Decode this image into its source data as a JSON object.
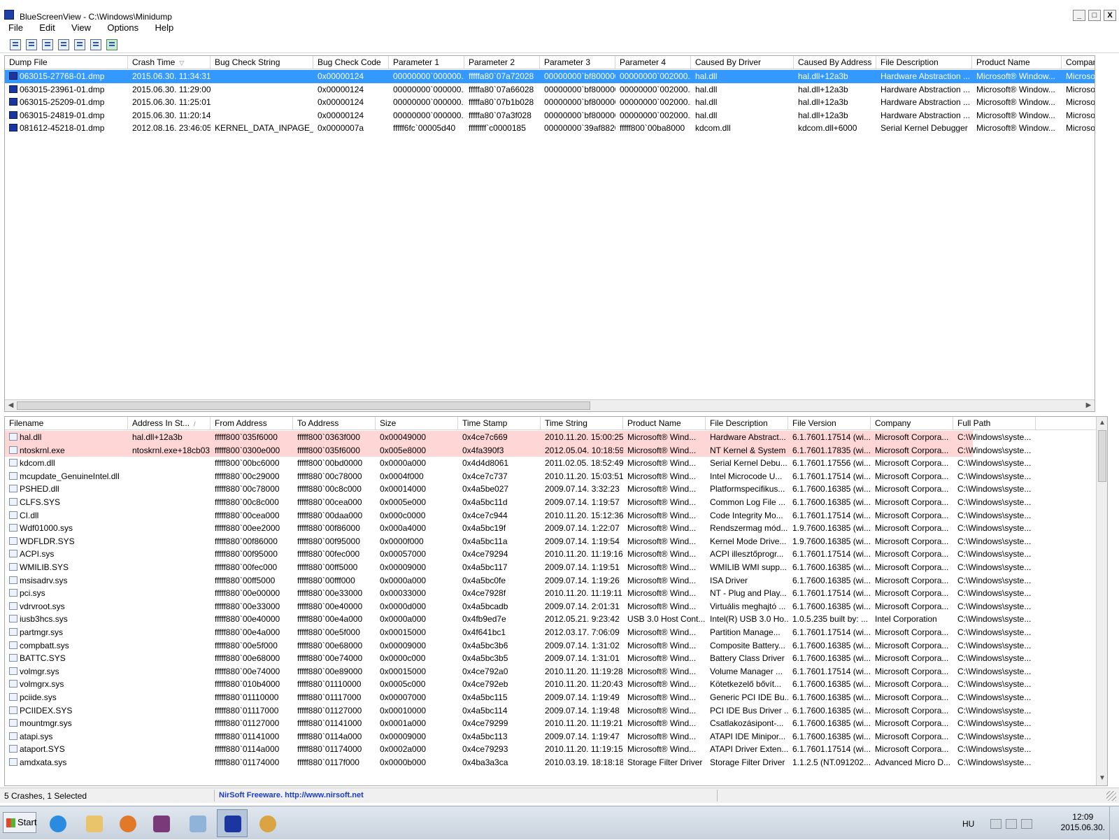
{
  "window": {
    "title": "BlueScreenView  -  C:\\Windows\\Minidump",
    "btn_min": "_",
    "btn_max": "□",
    "btn_close": "X"
  },
  "menu": [
    "File",
    "Edit",
    "View",
    "Options",
    "Help"
  ],
  "toolbar_icons": [
    "properties-icon",
    "save-icon",
    "refresh-icon",
    "copy-icon",
    "html-report-icon",
    "find-icon",
    "exit-icon"
  ],
  "crashes": {
    "columns": [
      "Dump File",
      "Crash Time",
      "Bug Check String",
      "Bug Check Code",
      "Parameter 1",
      "Parameter 2",
      "Parameter 3",
      "Parameter 4",
      "Caused By Driver",
      "Caused By Address",
      "File Description",
      "Product Name",
      "Compar"
    ],
    "sort_indicator": "▽",
    "rows": [
      [
        "063015-27768-01.dmp",
        "2015.06.30. 11:34:31",
        "",
        "0x00000124",
        "00000000`000000...",
        "fffffa80`07a72028",
        "00000000`bf800000",
        "00000000`002000...",
        "hal.dll",
        "hal.dll+12a3b",
        "Hardware Abstraction ...",
        "Microsoft® Window...",
        "Microso"
      ],
      [
        "063015-23961-01.dmp",
        "2015.06.30. 11:29:00",
        "",
        "0x00000124",
        "00000000`000000...",
        "fffffa80`07a66028",
        "00000000`bf800000",
        "00000000`002000...",
        "hal.dll",
        "hal.dll+12a3b",
        "Hardware Abstraction ...",
        "Microsoft® Window...",
        "Microso"
      ],
      [
        "063015-25209-01.dmp",
        "2015.06.30. 11:25:01",
        "",
        "0x00000124",
        "00000000`000000...",
        "fffffa80`07b1b028",
        "00000000`bf800000",
        "00000000`002000...",
        "hal.dll",
        "hal.dll+12a3b",
        "Hardware Abstraction ...",
        "Microsoft® Window...",
        "Microso"
      ],
      [
        "063015-24819-01.dmp",
        "2015.06.30. 11:20:14",
        "",
        "0x00000124",
        "00000000`000000...",
        "fffffa80`07a3f028",
        "00000000`bf800000",
        "00000000`002000...",
        "hal.dll",
        "hal.dll+12a3b",
        "Hardware Abstraction ...",
        "Microsoft® Window...",
        "Microso"
      ],
      [
        "081612-45218-01.dmp",
        "2012.08.16. 23:46:05",
        "KERNEL_DATA_INPAGE_...",
        "0x0000007a",
        "fffff6fc`00005d40",
        "ffffffff`c0000185",
        "00000000`39af8820",
        "fffff800`00ba8000",
        "kdcom.dll",
        "kdcom.dll+6000",
        "Serial Kernel Debugger",
        "Microsoft® Window...",
        "Microso"
      ]
    ],
    "selected_index": 0
  },
  "modules": {
    "columns": [
      "Filename",
      "Address In St...",
      "From Address",
      "To Address",
      "Size",
      "Time Stamp",
      "Time String",
      "Product Name",
      "File Description",
      "File Version",
      "Company",
      "Full Path"
    ],
    "sort_indicator": "/",
    "rows": [
      [
        "hal.dll",
        "hal.dll+12a3b",
        "fffff800`035f6000",
        "fffff800`0363f000",
        "0x00049000",
        "0x4ce7c669",
        "2010.11.20. 15:00:25",
        "Microsoft® Wind...",
        "Hardware Abstract...",
        "6.1.7601.17514 (wi...",
        "Microsoft Corpora...",
        "C:\\Windows\\syste..."
      ],
      [
        "ntoskrnl.exe",
        "ntoskrnl.exe+18cb03",
        "fffff800`0300e000",
        "fffff800`035f6000",
        "0x005e8000",
        "0x4fa390f3",
        "2012.05.04. 10:18:59",
        "Microsoft® Wind...",
        "NT Kernel & System",
        "6.1.7601.17835 (wi...",
        "Microsoft Corpora...",
        "C:\\Windows\\syste..."
      ],
      [
        "kdcom.dll",
        "",
        "fffff800`00bc6000",
        "fffff800`00bd0000",
        "0x0000a000",
        "0x4d4d8061",
        "2011.02.05. 18:52:49",
        "Microsoft® Wind...",
        "Serial Kernel Debu...",
        "6.1.7601.17556 (wi...",
        "Microsoft Corpora...",
        "C:\\Windows\\syste..."
      ],
      [
        "mcupdate_GenuineIntel.dll",
        "",
        "fffff880`00c29000",
        "fffff880`00c78000",
        "0x0004f000",
        "0x4ce7c737",
        "2010.11.20. 15:03:51",
        "Microsoft® Wind...",
        "Intel Microcode U...",
        "6.1.7601.17514 (wi...",
        "Microsoft Corpora...",
        "C:\\Windows\\syste..."
      ],
      [
        "PSHED.dll",
        "",
        "fffff880`00c78000",
        "fffff880`00c8c000",
        "0x00014000",
        "0x4a5be027",
        "2009.07.14. 3:32:23",
        "Microsoft® Wind...",
        "Platformspecifikus...",
        "6.1.7600.16385 (wi...",
        "Microsoft Corpora...",
        "C:\\Windows\\syste..."
      ],
      [
        "CLFS.SYS",
        "",
        "fffff880`00c8c000",
        "fffff880`00cea000",
        "0x0005e000",
        "0x4a5bc11d",
        "2009.07.14. 1:19:57",
        "Microsoft® Wind...",
        "Common Log File ...",
        "6.1.7600.16385 (wi...",
        "Microsoft Corpora...",
        "C:\\Windows\\syste..."
      ],
      [
        "CI.dll",
        "",
        "fffff880`00cea000",
        "fffff880`00daa000",
        "0x000c0000",
        "0x4ce7c944",
        "2010.11.20. 15:12:36",
        "Microsoft® Wind...",
        "Code Integrity Mo...",
        "6.1.7601.17514 (wi...",
        "Microsoft Corpora...",
        "C:\\Windows\\syste..."
      ],
      [
        "Wdf01000.sys",
        "",
        "fffff880`00ee2000",
        "fffff880`00f86000",
        "0x000a4000",
        "0x4a5bc19f",
        "2009.07.14. 1:22:07",
        "Microsoft® Wind...",
        "Rendszermag mód...",
        "1.9.7600.16385 (wi...",
        "Microsoft Corpora...",
        "C:\\Windows\\syste..."
      ],
      [
        "WDFLDR.SYS",
        "",
        "fffff880`00f86000",
        "fffff880`00f95000",
        "0x0000f000",
        "0x4a5bc11a",
        "2009.07.14. 1:19:54",
        "Microsoft® Wind...",
        "Kernel Mode Drive...",
        "1.9.7600.16385 (wi...",
        "Microsoft Corpora...",
        "C:\\Windows\\syste..."
      ],
      [
        "ACPI.sys",
        "",
        "fffff880`00f95000",
        "fffff880`00fec000",
        "0x00057000",
        "0x4ce79294",
        "2010.11.20. 11:19:16",
        "Microsoft® Wind...",
        "ACPI illesztőprogr...",
        "6.1.7601.17514 (wi...",
        "Microsoft Corpora...",
        "C:\\Windows\\syste..."
      ],
      [
        "WMILIB.SYS",
        "",
        "fffff880`00fec000",
        "fffff880`00ff5000",
        "0x00009000",
        "0x4a5bc117",
        "2009.07.14. 1:19:51",
        "Microsoft® Wind...",
        "WMILIB WMI supp...",
        "6.1.7600.16385 (wi...",
        "Microsoft Corpora...",
        "C:\\Windows\\syste..."
      ],
      [
        "msisadrv.sys",
        "",
        "fffff880`00ff5000",
        "fffff880`00fff000",
        "0x0000a000",
        "0x4a5bc0fe",
        "2009.07.14. 1:19:26",
        "Microsoft® Wind...",
        "ISA Driver",
        "6.1.7600.16385 (wi...",
        "Microsoft Corpora...",
        "C:\\Windows\\syste..."
      ],
      [
        "pci.sys",
        "",
        "fffff880`00e00000",
        "fffff880`00e33000",
        "0x00033000",
        "0x4ce7928f",
        "2010.11.20. 11:19:11",
        "Microsoft® Wind...",
        "NT - Plug and Play...",
        "6.1.7601.17514 (wi...",
        "Microsoft Corpora...",
        "C:\\Windows\\syste..."
      ],
      [
        "vdrvroot.sys",
        "",
        "fffff880`00e33000",
        "fffff880`00e40000",
        "0x0000d000",
        "0x4a5bcadb",
        "2009.07.14. 2:01:31",
        "Microsoft® Wind...",
        "Virtuális meghajtó ...",
        "6.1.7600.16385 (wi...",
        "Microsoft Corpora...",
        "C:\\Windows\\syste..."
      ],
      [
        "iusb3hcs.sys",
        "",
        "fffff880`00e40000",
        "fffff880`00e4a000",
        "0x0000a000",
        "0x4fb9ed7e",
        "2012.05.21. 9:23:42",
        "USB 3.0 Host Cont...",
        "Intel(R) USB 3.0 Ho...",
        "1.0.5.235 built by: ...",
        "Intel Corporation",
        "C:\\Windows\\syste..."
      ],
      [
        "partmgr.sys",
        "",
        "fffff880`00e4a000",
        "fffff880`00e5f000",
        "0x00015000",
        "0x4f641bc1",
        "2012.03.17. 7:06:09",
        "Microsoft® Wind...",
        "Partition Manage...",
        "6.1.7601.17514 (wi...",
        "Microsoft Corpora...",
        "C:\\Windows\\syste..."
      ],
      [
        "compbatt.sys",
        "",
        "fffff880`00e5f000",
        "fffff880`00e68000",
        "0x00009000",
        "0x4a5bc3b6",
        "2009.07.14. 1:31:02",
        "Microsoft® Wind...",
        "Composite Battery...",
        "6.1.7600.16385 (wi...",
        "Microsoft Corpora...",
        "C:\\Windows\\syste..."
      ],
      [
        "BATTC.SYS",
        "",
        "fffff880`00e68000",
        "fffff880`00e74000",
        "0x0000c000",
        "0x4a5bc3b5",
        "2009.07.14. 1:31:01",
        "Microsoft® Wind...",
        "Battery Class Driver",
        "6.1.7600.16385 (wi...",
        "Microsoft Corpora...",
        "C:\\Windows\\syste..."
      ],
      [
        "volmgr.sys",
        "",
        "fffff880`00e74000",
        "fffff880`00e89000",
        "0x00015000",
        "0x4ce792a0",
        "2010.11.20. 11:19:28",
        "Microsoft® Wind...",
        "Volume Manager ...",
        "6.1.7601.17514 (wi...",
        "Microsoft Corpora...",
        "C:\\Windows\\syste..."
      ],
      [
        "volmgrx.sys",
        "",
        "fffff880`010b4000",
        "fffff880`01110000",
        "0x0005c000",
        "0x4ce792eb",
        "2010.11.20. 11:20:43",
        "Microsoft® Wind...",
        "Kötetkezelő bővít...",
        "6.1.7600.16385 (wi...",
        "Microsoft Corpora...",
        "C:\\Windows\\syste..."
      ],
      [
        "pciide.sys",
        "",
        "fffff880`01110000",
        "fffff880`01117000",
        "0x00007000",
        "0x4a5bc115",
        "2009.07.14. 1:19:49",
        "Microsoft® Wind...",
        "Generic PCI IDE Bu...",
        "6.1.7600.16385 (wi...",
        "Microsoft Corpora...",
        "C:\\Windows\\syste..."
      ],
      [
        "PCIIDEX.SYS",
        "",
        "fffff880`01117000",
        "fffff880`01127000",
        "0x00010000",
        "0x4a5bc114",
        "2009.07.14. 1:19:48",
        "Microsoft® Wind...",
        "PCI IDE Bus Driver ...",
        "6.1.7600.16385 (wi...",
        "Microsoft Corpora...",
        "C:\\Windows\\syste..."
      ],
      [
        "mountmgr.sys",
        "",
        "fffff880`01127000",
        "fffff880`01141000",
        "0x0001a000",
        "0x4ce79299",
        "2010.11.20. 11:19:21",
        "Microsoft® Wind...",
        "Csatlakozásipont-...",
        "6.1.7600.16385 (wi...",
        "Microsoft Corpora...",
        "C:\\Windows\\syste..."
      ],
      [
        "atapi.sys",
        "",
        "fffff880`01141000",
        "fffff880`0114a000",
        "0x00009000",
        "0x4a5bc113",
        "2009.07.14. 1:19:47",
        "Microsoft® Wind...",
        "ATAPI IDE Minipor...",
        "6.1.7600.16385 (wi...",
        "Microsoft Corpora...",
        "C:\\Windows\\syste..."
      ],
      [
        "ataport.SYS",
        "",
        "fffff880`0114a000",
        "fffff880`01174000",
        "0x0002a000",
        "0x4ce79293",
        "2010.11.20. 11:19:15",
        "Microsoft® Wind...",
        "ATAPI Driver Exten...",
        "6.1.7601.17514 (wi...",
        "Microsoft Corpora...",
        "C:\\Windows\\syste..."
      ],
      [
        "amdxata.sys",
        "",
        "fffff880`01174000",
        "fffff880`0117f000",
        "0x0000b000",
        "0x4ba3a3ca",
        "2010.03.19. 18:18:18",
        "Storage Filter Driver",
        "Storage Filter Driver",
        "1.1.2.5 (NT.091202...",
        "Advanced Micro D...",
        "C:\\Windows\\syste..."
      ]
    ],
    "highlighted_indices": [
      0,
      1
    ]
  },
  "status": {
    "summary": "5 Crashes, 1 Selected",
    "credit": "NirSoft Freeware.  http://www.nirsoft.net"
  },
  "taskbar": {
    "start_label": "Start",
    "apps": [
      "internet-explorer-icon",
      "explorer-folder-icon",
      "media-player-icon",
      "winrar-icon",
      "notepad-icon",
      "bluescreenview-icon",
      "paint-icon"
    ],
    "language": "HU",
    "clock_time": "12:09",
    "clock_date": "2015.06.30."
  },
  "colors": {
    "selection": "#3399ff",
    "highlight_row": "#ffd6d6",
    "credit_link": "#1a3cc8"
  }
}
